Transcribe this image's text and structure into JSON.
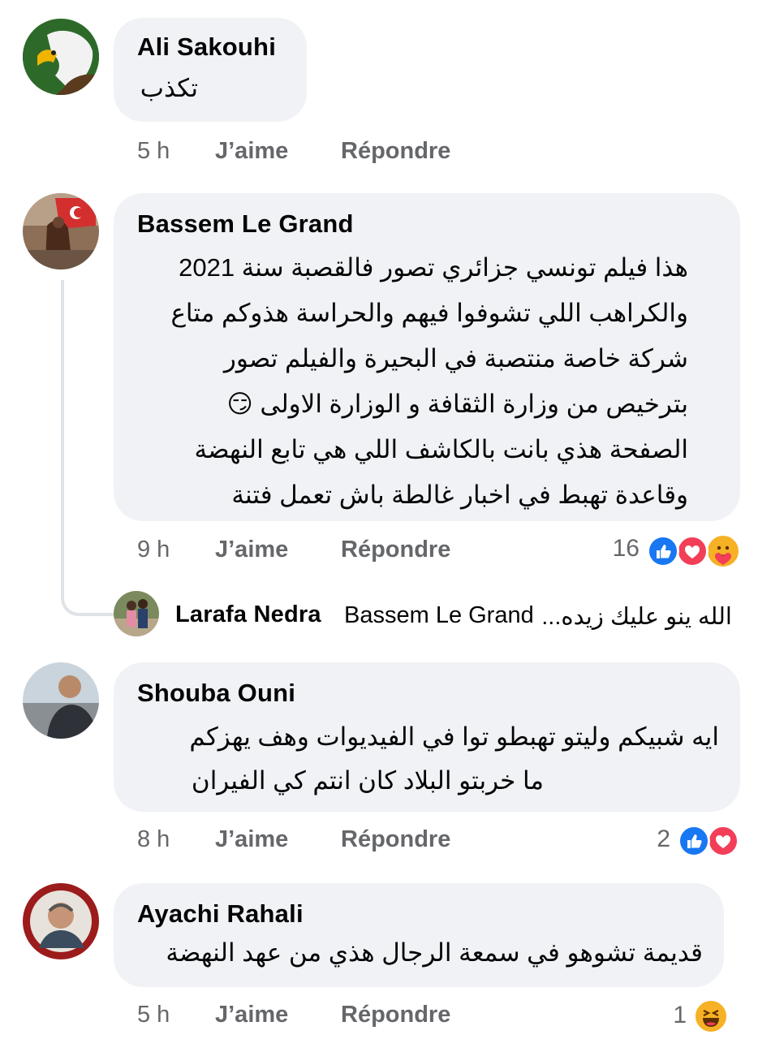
{
  "comments": [
    {
      "author": "Ali Sakouhi",
      "lines": [
        "تكذب"
      ],
      "time": "5 h",
      "like_label": "J’aime",
      "reply_label": "Répondre",
      "reaction_count": "",
      "reactions": []
    },
    {
      "author": "Bassem Le Grand",
      "lines": [
        "هذا فيلم تونسي جزائري تصور فالقصبة سنة 2021",
        "والكراهب اللي تشوفوا فيهم والحراسة هذوكم متاع",
        "شركة خاصة منتصبة في البحيرة والفيلم تصور",
        "بترخيص من وزارة الثقافة و الوزارة الاولى 😏",
        "الصفحة هذي بانت بالكاشف اللي هي تابع النهضة",
        "وقاعدة تهبط في اخبار غالطة باش تعمل فتنة"
      ],
      "time": "9 h",
      "like_label": "J’aime",
      "reply_label": "Répondre",
      "reaction_count": "16",
      "reactions": [
        "like-icon",
        "love-icon",
        "care-icon"
      ]
    },
    {
      "author": "Shouba Ouni",
      "lines": [
        "ايه شبيكم وليتو تهبطو توا في الفيديوات وهف يهزكم",
        "ما خربتو البلاد كان انتم كي الفيران"
      ],
      "time": "8 h",
      "like_label": "J’aime",
      "reply_label": "Répondre",
      "reaction_count": "2",
      "reactions": [
        "like-icon",
        "love-icon"
      ]
    },
    {
      "author": "Ayachi Rahali",
      "lines": [
        "قديمة تشوهو في سمعة الرجال هذي من عهد النهضة"
      ],
      "time": "5 h",
      "like_label": "J’aime",
      "reply_label": "Répondre",
      "reaction_count": "1",
      "reactions": [
        "haha-icon"
      ]
    }
  ],
  "reply_preview": {
    "author": "Larafa Nedra",
    "mention": "Bassem Le Grand",
    "text": "الله ينو عليك زيده..."
  },
  "colors": {
    "bubble": "#f0f2f5",
    "meta_text": "#65676b",
    "like_blue": "#1877f2",
    "love_red": "#f33e58",
    "haha_yellow": "#f7b125"
  }
}
